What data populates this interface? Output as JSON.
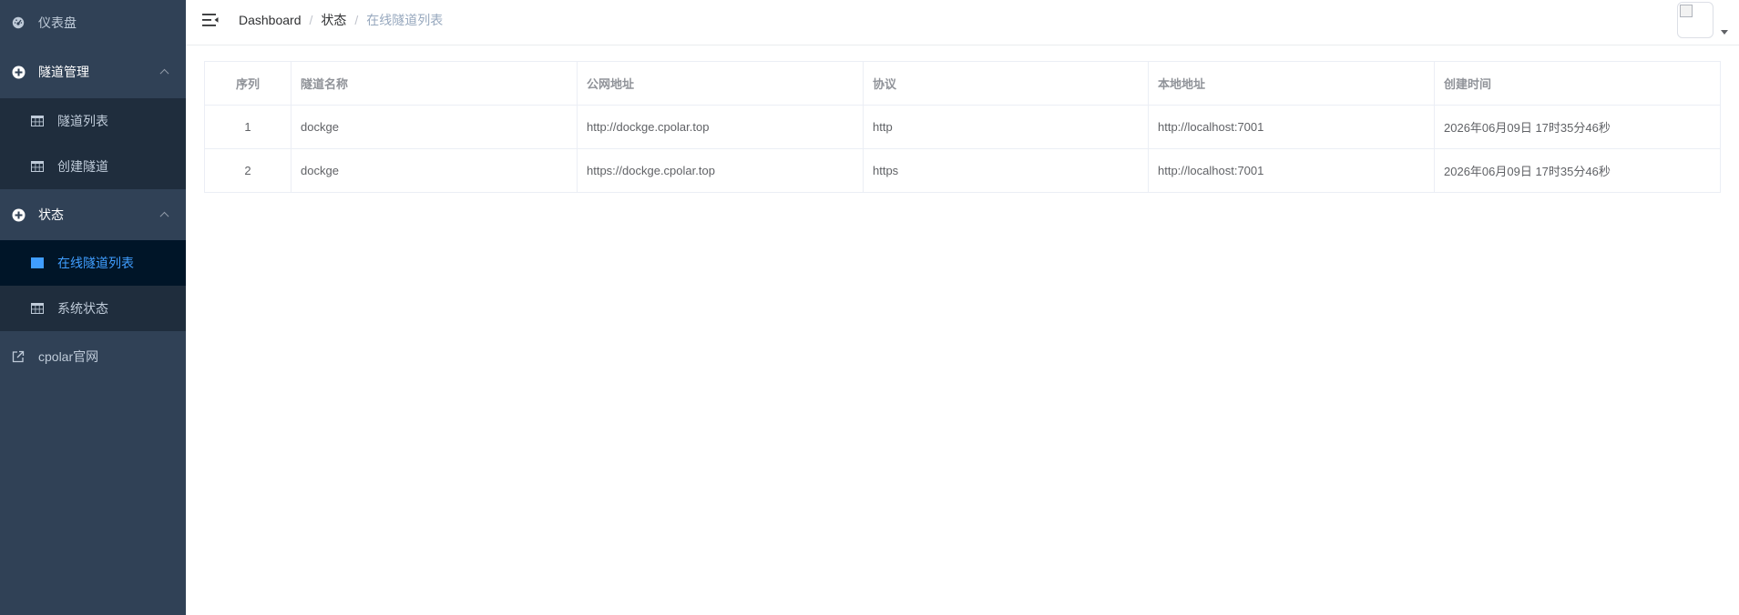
{
  "sidebar": {
    "dashboard": {
      "label": "仪表盘",
      "icon": "dashboard-icon"
    },
    "tunnel_mgmt": {
      "label": "隧道管理",
      "icon": "plus-circle-icon",
      "items": [
        {
          "label": "隧道列表",
          "icon": "table-icon"
        },
        {
          "label": "创建隧道",
          "icon": "table-icon"
        }
      ]
    },
    "status": {
      "label": "状态",
      "icon": "plus-circle-icon",
      "items": [
        {
          "label": "在线隧道列表",
          "icon": "table-icon",
          "active": true
        },
        {
          "label": "系统状态",
          "icon": "table-icon"
        }
      ]
    },
    "official_site": {
      "label": "cpolar官网",
      "icon": "external-link-icon"
    }
  },
  "navbar": {
    "breadcrumb": [
      "Dashboard",
      "状态",
      "在线隧道列表"
    ]
  },
  "table": {
    "columns": [
      "序列",
      "隧道名称",
      "公网地址",
      "协议",
      "本地地址",
      "创建时间"
    ],
    "rows": [
      [
        "1",
        "dockge",
        "http://dockge.cpolar.top",
        "http",
        "http://localhost:7001",
        "2026年06月09日 17时35分46秒"
      ],
      [
        "2",
        "dockge",
        "https://dockge.cpolar.top",
        "https",
        "http://localhost:7001",
        "2026年06月09日 17时35分46秒"
      ]
    ]
  },
  "colors": {
    "sidebar_bg": "#304156",
    "submenu_bg": "#1f2d3d",
    "active_bg": "#001528",
    "accent": "#409eff"
  }
}
